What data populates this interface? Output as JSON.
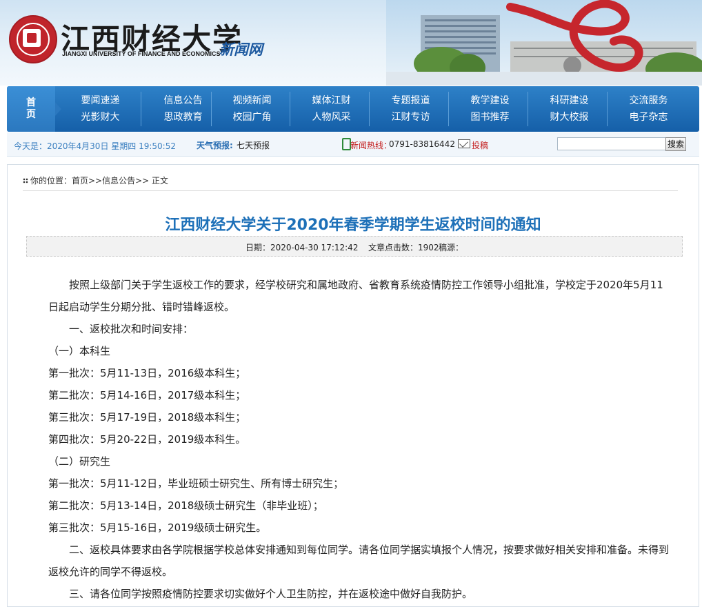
{
  "header": {
    "logo_cn": "江西财经大学",
    "logo_en": "JIANGXI UNIVERSITY OF FINANCE AND ECONOMICS",
    "site_name": "新闻网"
  },
  "nav": {
    "home": [
      "首",
      "页"
    ],
    "columns": [
      [
        "要闻速递",
        "光影财大"
      ],
      [
        "信息公告",
        "思政教育"
      ],
      [
        "视频新闻",
        "校园广角"
      ],
      [
        "媒体江财",
        "人物风采"
      ],
      [
        "专题报道",
        "江财专访"
      ],
      [
        "教学建设",
        "图书推荐"
      ],
      [
        "科研建设",
        "财大校报"
      ],
      [
        "交流服务",
        "电子杂志"
      ]
    ]
  },
  "infobar": {
    "date": "今天是：2020年4月30日 星期四 19:50:52",
    "weather_label": "天气预报:",
    "weather_value": "七天预报",
    "hotline_label": "新闻热线：",
    "hotline_value": "0791-83816442",
    "submit_label": "投稿",
    "search_value": "",
    "search_button": "搜索"
  },
  "article": {
    "breadcrumb": "你的位置：首页>>信息公告>> 正文",
    "title": "江西财经大学关于2020年春季学期学生返校时间的通知",
    "date": "日期：2020-04-30 17:12:42",
    "clicks": "文章点击数：1902",
    "source": "稿源：",
    "paragraphs": [
      {
        "text": "按照上级部门关于学生返校工作的要求，经学校研究和属地政府、省教育系统疫情防控工作领导小组批准，学校定于2020年5月11日起启动学生分期分批、错时错峰返校。",
        "indent": true
      },
      {
        "text": "一、返校批次和时间安排：",
        "indent": true
      },
      {
        "text": "（一）本科生",
        "indent": false
      },
      {
        "text": "第一批次：5月11-13日，2016级本科生；",
        "indent": false
      },
      {
        "text": "第二批次：5月14-16日，2017级本科生；",
        "indent": false
      },
      {
        "text": "第三批次：5月17-19日，2018级本科生；",
        "indent": false
      },
      {
        "text": "第四批次：5月20-22日，2019级本科生。",
        "indent": false
      },
      {
        "text": "（二）研究生",
        "indent": false
      },
      {
        "text": "第一批次：5月11-12日，毕业班硕士研究生、所有博士研究生；",
        "indent": false
      },
      {
        "text": "第二批次：5月13-14日，2018级硕士研究生（非毕业班）；",
        "indent": false
      },
      {
        "text": "第三批次：5月15-16日，2019级硕士研究生。",
        "indent": false
      },
      {
        "text": "二、返校具体要求由各学院根据学校总体安排通知到每位同学。请各位同学据实填报个人情况，按要求做好相关安排和准备。未得到返校允许的同学不得返校。",
        "indent": true
      },
      {
        "text": "三、请各位同学按照疫情防控要求切实做好个人卫生防控，并在返校途中做好自我防护。",
        "indent": true
      }
    ]
  }
}
